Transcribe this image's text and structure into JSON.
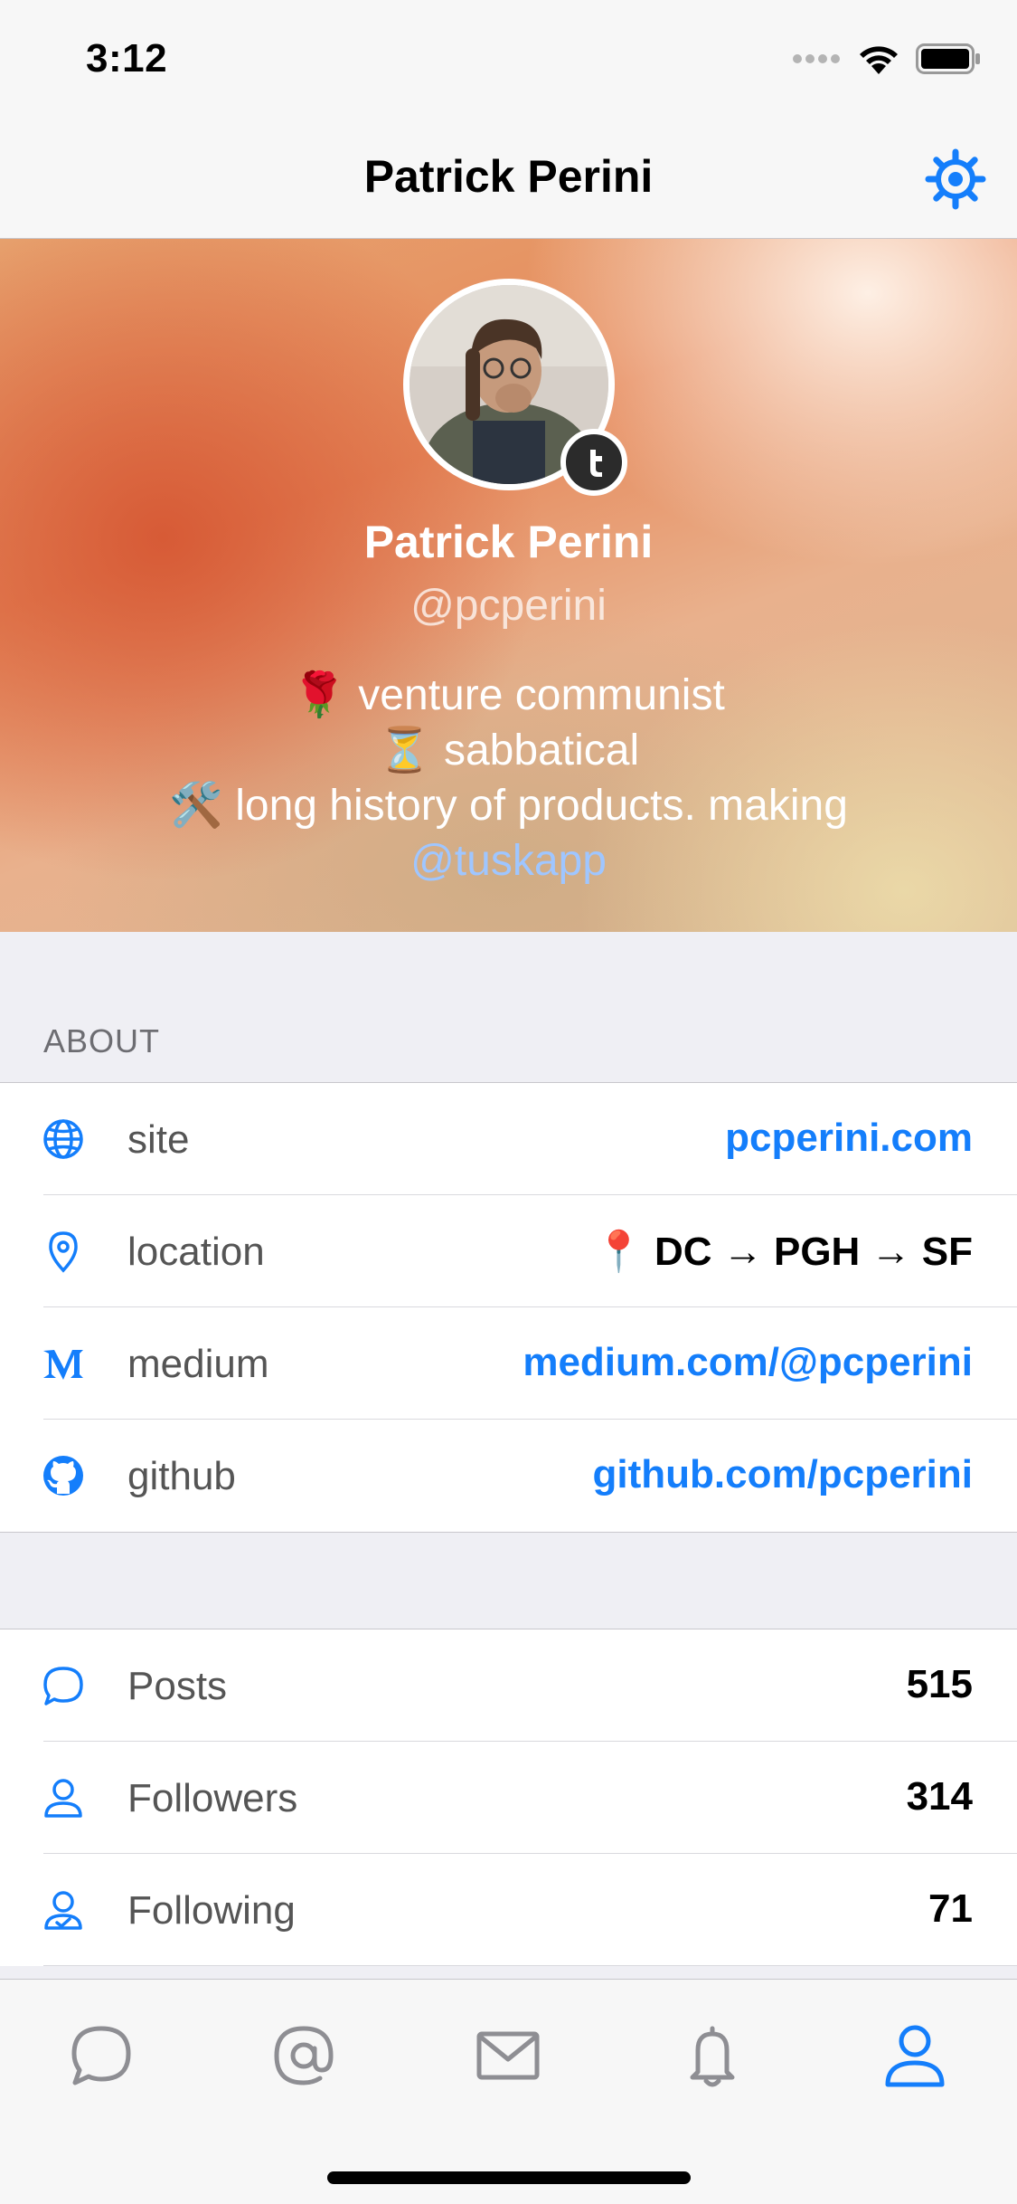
{
  "status_bar": {
    "time": "3:12"
  },
  "nav": {
    "title": "Patrick Perini"
  },
  "profile": {
    "name": "Patrick Perini",
    "handle": "@pcperini",
    "bio_line1": "🌹 venture communist",
    "bio_line2": "⏳ sabbatical",
    "bio_line3": "🛠️ long history of products. making",
    "bio_link": "@tuskapp"
  },
  "about": {
    "label": "ABOUT",
    "rows": [
      {
        "icon": "globe-icon",
        "label": "site",
        "value": "pcperini.com",
        "link": true
      },
      {
        "icon": "location-pin-icon",
        "label": "location",
        "value": "📍 DC → PGH → SF",
        "link": false
      },
      {
        "icon": "medium-icon",
        "label": "medium",
        "value": "medium.com/@pcperini",
        "link": true
      },
      {
        "icon": "github-icon",
        "label": "github",
        "value": "github.com/pcperini",
        "link": true
      }
    ]
  },
  "stats": {
    "rows": [
      {
        "icon": "speech-bubble-icon",
        "label": "Posts",
        "value": "515"
      },
      {
        "icon": "person-icon",
        "label": "Followers",
        "value": "314"
      },
      {
        "icon": "person-check-icon",
        "label": "Following",
        "value": "71"
      }
    ]
  },
  "tabs": [
    {
      "icon": "speech-bubble-icon",
      "active": false
    },
    {
      "icon": "at-sign-icon",
      "active": false
    },
    {
      "icon": "envelope-icon",
      "active": false
    },
    {
      "icon": "bell-icon",
      "active": false
    },
    {
      "icon": "person-icon",
      "active": true
    }
  ],
  "colors": {
    "accent": "#147efb",
    "inactive_tab": "#8e8e93",
    "background": "#efeff4"
  }
}
